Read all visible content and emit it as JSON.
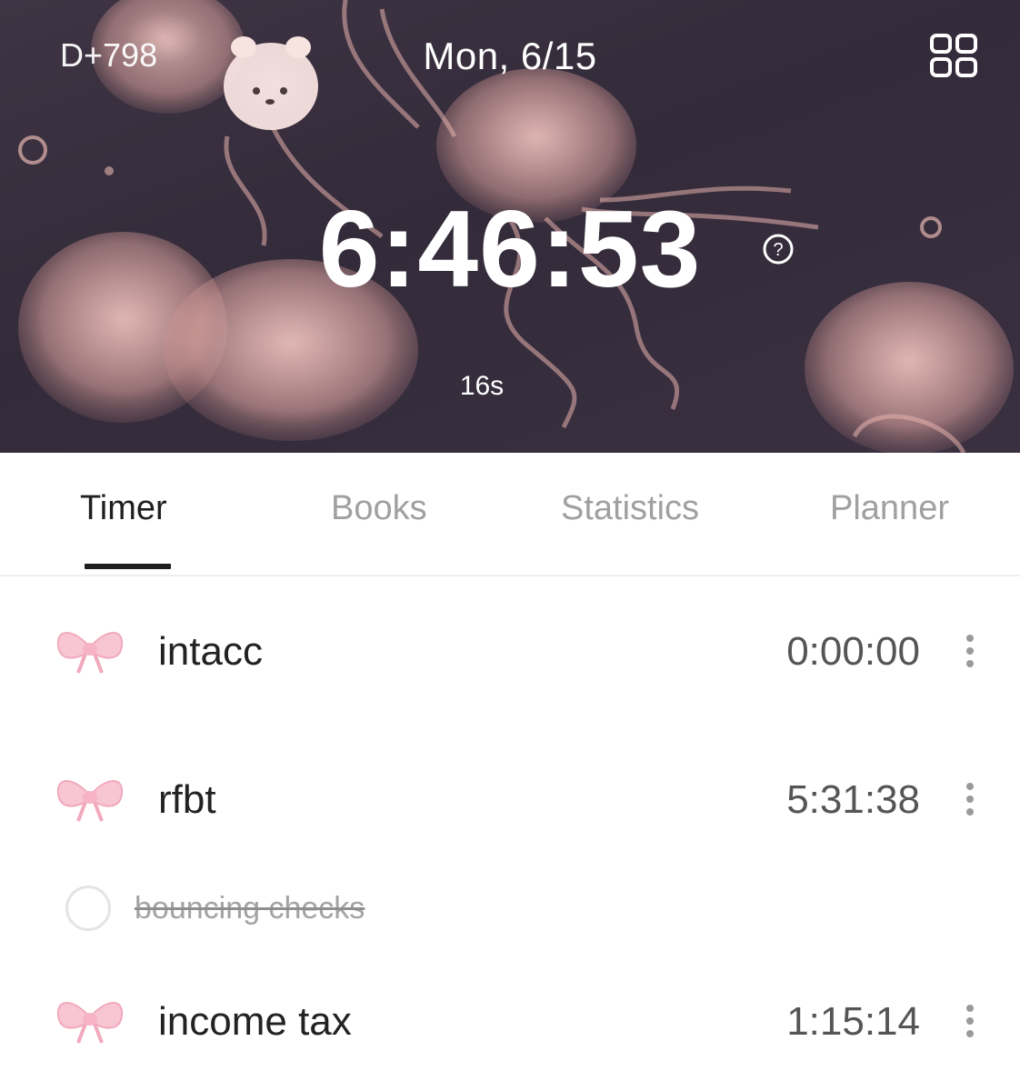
{
  "header": {
    "d_day": "D+798",
    "date": "Mon, 6/15",
    "total_time": "6:46:53",
    "seconds": "16s",
    "menu_icon": "grid-icon",
    "help_icon": "help-circle-icon"
  },
  "tabs": [
    {
      "label": "Timer",
      "active": true
    },
    {
      "label": "Books",
      "active": false
    },
    {
      "label": "Statistics",
      "active": false
    },
    {
      "label": "Planner",
      "active": false
    }
  ],
  "subjects": [
    {
      "name": "intacc",
      "time": "0:00:00",
      "icon": "pink-bow-icon"
    },
    {
      "name": "rfbt",
      "time": "5:31:38",
      "icon": "pink-bow-icon"
    },
    {
      "name": "income tax",
      "time": "1:15:14",
      "icon": "pink-bow-icon"
    }
  ],
  "tasks": [
    {
      "label": "bouncing checks",
      "completed": true
    }
  ],
  "colors": {
    "hero_bg": "#3a3040",
    "jellyfish": "#e8b2ad",
    "active_tab": "#1f1f1f",
    "inactive_tab": "#a0a0a0",
    "bow": "#f6c3d0"
  }
}
